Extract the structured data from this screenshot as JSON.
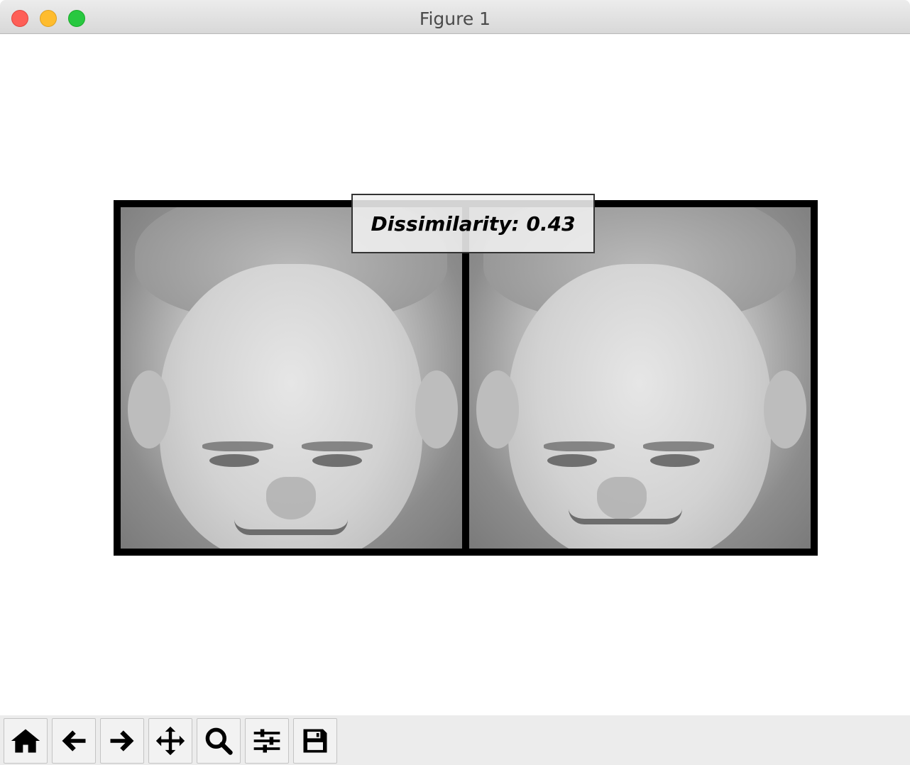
{
  "window": {
    "title": "Figure 1"
  },
  "figure": {
    "annotation_text": "Dissimilarity: 0.43",
    "images": [
      {
        "subject": "face-left"
      },
      {
        "subject": "face-right"
      }
    ]
  },
  "toolbar": {
    "buttons": [
      {
        "icon": "home-icon"
      },
      {
        "icon": "back-arrow-icon"
      },
      {
        "icon": "forward-arrow-icon"
      },
      {
        "icon": "pan-icon"
      },
      {
        "icon": "zoom-icon"
      },
      {
        "icon": "configure-subplots-icon"
      },
      {
        "icon": "save-icon"
      }
    ]
  },
  "colors": {
    "close": "#fe5f57",
    "minimize": "#febc2e",
    "maximize": "#28c840"
  }
}
